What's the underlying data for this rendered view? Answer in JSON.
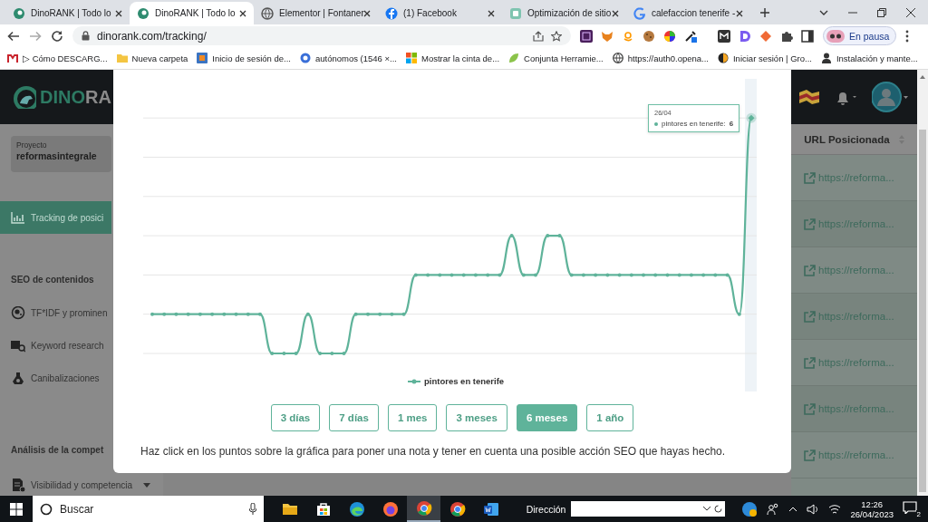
{
  "browser": {
    "tabs": [
      {
        "title": "DinoRANK | Todo lo",
        "selected": false
      },
      {
        "title": "DinoRANK | Todo lo",
        "selected": true
      },
      {
        "title": "Elementor | Fontaner",
        "selected": false
      },
      {
        "title": "(1) Facebook",
        "selected": false
      },
      {
        "title": "Optimización de sitio",
        "selected": false
      },
      {
        "title": "calefaccion tenerife -",
        "selected": false
      }
    ],
    "url": "dinorank.com/tracking/",
    "profile": "En pausa",
    "bookmarks": [
      "▷ Cómo DESCARG...",
      "Nueva carpeta",
      "Inicio de sesión de...",
      "autónomos (1546 ×...",
      "Mostrar la cinta de...",
      "Conjunta Herramie...",
      "https://auth0.opena...",
      "Iniciar sesión | Gro...",
      "Instalación y mante..."
    ]
  },
  "page": {
    "logo_main": "DINO",
    "logo_tail": "RA",
    "project_label": "Proyecto",
    "project": "reformasintegrale",
    "sidebar": [
      {
        "kind": "item",
        "label": "Tracking de posici",
        "selected": true
      },
      {
        "kind": "heading",
        "label": "SEO de contenidos"
      },
      {
        "kind": "item",
        "label": "TF*IDF y prominen",
        "selected": false
      },
      {
        "kind": "item",
        "label": "Keyword research",
        "selected": false
      },
      {
        "kind": "item",
        "label": "Canibalizaciones",
        "selected": false
      },
      {
        "kind": "heading",
        "label": "Análisis de la compet"
      },
      {
        "kind": "item",
        "label": "Visibilidad y competencia",
        "selected": false
      }
    ],
    "table": {
      "column": "URL Posicionada",
      "rows": [
        "https://reforma...",
        "https://reforma...",
        "https://reforma...",
        "https://reforma...",
        "https://reforma...",
        "https://reforma...",
        "https://reforma..."
      ]
    }
  },
  "modal": {
    "tooltip": {
      "date": "26/04",
      "series": "pintores en tenerife:",
      "value": "6"
    },
    "legend": "pintores en tenerife",
    "ranges": [
      {
        "label": "3 días",
        "selected": false
      },
      {
        "label": "7 días",
        "selected": false
      },
      {
        "label": "1 mes",
        "selected": false
      },
      {
        "label": "3 meses",
        "selected": false
      },
      {
        "label": "6 meses",
        "selected": true
      },
      {
        "label": "1 año",
        "selected": false
      }
    ],
    "hint": "Haz click en los puntos sobre la gráfica para poner una nota y tener en cuenta una posible acción SEO que hayas hecho."
  },
  "taskbar": {
    "search": "Buscar",
    "address_label": "Dirección",
    "time": "12:26",
    "date": "26/04/2023",
    "notifications": "2"
  }
}
